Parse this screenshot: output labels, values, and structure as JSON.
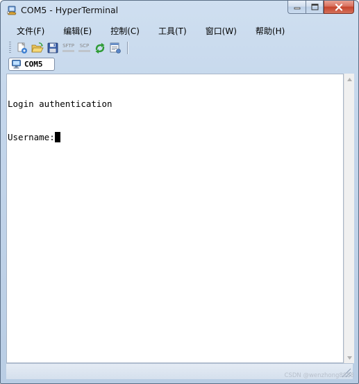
{
  "window": {
    "title": "COM5 - HyperTerminal",
    "app_icon": "hyperterminal-phone-icon"
  },
  "caption_buttons": {
    "minimize_icon": "minimize-icon",
    "maximize_icon": "maximize-icon",
    "close_icon": "close-icon"
  },
  "menu": {
    "items": [
      {
        "label": "文件(F)"
      },
      {
        "label": "编辑(E)"
      },
      {
        "label": "控制(C)"
      },
      {
        "label": "工具(T)"
      },
      {
        "label": "窗口(W)"
      },
      {
        "label": "帮助(H)"
      }
    ]
  },
  "toolbar": {
    "new_icon": "new-connection-icon",
    "open_icon": "open-folder-icon",
    "save_icon": "save-disk-icon",
    "sftp_label": "SFTP",
    "scp_label": "SCP",
    "reconnect_icon": "reconnect-arrow-icon",
    "properties_icon": "properties-icon"
  },
  "session_tab": {
    "label": "COM5",
    "icon": "terminal-monitor-icon"
  },
  "terminal": {
    "lines": [
      "Login authentication",
      "Username:"
    ]
  },
  "watermark": "CSDN @wenzhong8888",
  "colors": {
    "window_frame": "#c4d6eb",
    "close_button": "#c6432b",
    "terminal_bg": "#ffffff",
    "terminal_text": "#000000"
  }
}
